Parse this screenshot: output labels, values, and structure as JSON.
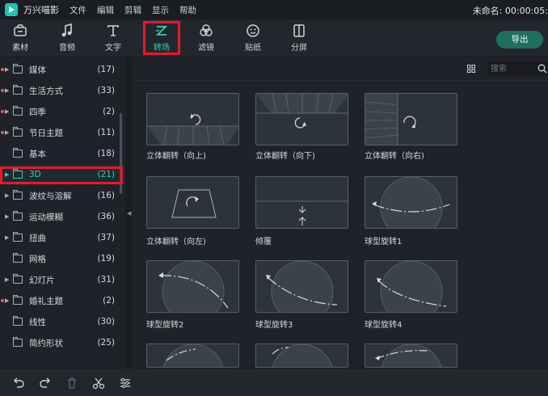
{
  "menubar": {
    "app_title": "万兴喵影",
    "items": [
      "文件",
      "编辑",
      "剪辑",
      "显示",
      "帮助"
    ],
    "project_info": "未命名: 00:00:05:"
  },
  "toolbar": {
    "tools": [
      {
        "label": "素材",
        "icon": "media-icon"
      },
      {
        "label": "音频",
        "icon": "music-note-icon"
      },
      {
        "label": "文字",
        "icon": "text-icon"
      },
      {
        "label": "转场",
        "icon": "transition-icon",
        "active": true
      },
      {
        "label": "滤镜",
        "icon": "filter-icon"
      },
      {
        "label": "贴纸",
        "icon": "sticker-icon"
      },
      {
        "label": "分屏",
        "icon": "split-screen-icon"
      }
    ],
    "export_label": "导出"
  },
  "sidebar": {
    "categories": [
      {
        "name": "媒体",
        "count": "(17)",
        "expandable": true,
        "dot": true
      },
      {
        "name": "生活方式",
        "count": "(33)",
        "expandable": true,
        "dot": true
      },
      {
        "name": "四季",
        "count": "(2)",
        "expandable": true,
        "dot": true
      },
      {
        "name": "节日主题",
        "count": "(11)",
        "expandable": true,
        "dot": true
      },
      {
        "name": "基本",
        "count": "(18)",
        "expandable": false,
        "dot": false
      },
      {
        "name": "3D",
        "count": "(21)",
        "expandable": true,
        "dot": false,
        "selected": true
      },
      {
        "name": "波纹与溶解",
        "count": "(16)",
        "expandable": true,
        "dot": false
      },
      {
        "name": "运动模糊",
        "count": "(36)",
        "expandable": true,
        "dot": false
      },
      {
        "name": "扭曲",
        "count": "(37)",
        "expandable": true,
        "dot": false
      },
      {
        "name": "网格",
        "count": "(19)",
        "expandable": false,
        "dot": false
      },
      {
        "name": "幻灯片",
        "count": "(31)",
        "expandable": true,
        "dot": false
      },
      {
        "name": "婚礼主题",
        "count": "(2)",
        "expandable": true,
        "dot": true
      },
      {
        "name": "线性",
        "count": "(30)",
        "expandable": false,
        "dot": false
      },
      {
        "name": "简约形状",
        "count": "(25)",
        "expandable": false,
        "dot": false
      }
    ]
  },
  "search": {
    "placeholder": "搜索"
  },
  "transitions": [
    {
      "label": "立体翻转（向上)",
      "kind": "flip-up"
    },
    {
      "label": "立体翻转（向下)",
      "kind": "flip-down"
    },
    {
      "label": "立体翻转（向右)",
      "kind": "flip-right"
    },
    {
      "label": "立体翻转（向左)",
      "kind": "flip-left"
    },
    {
      "label": "倾覆",
      "kind": "overturn"
    },
    {
      "label": "球型旋转1",
      "kind": "sphere-1"
    },
    {
      "label": "球型旋转2",
      "kind": "sphere-2"
    },
    {
      "label": "球型旋转3",
      "kind": "sphere-3"
    },
    {
      "label": "球型旋转4",
      "kind": "sphere-4"
    },
    {
      "label": "",
      "kind": "sphere-5"
    },
    {
      "label": "",
      "kind": "sphere-6"
    },
    {
      "label": "",
      "kind": "sphere-7"
    }
  ],
  "bottombar": {
    "icons": [
      "undo-icon",
      "redo-icon",
      "trash-icon",
      "scissors-icon",
      "adjust-icon"
    ]
  },
  "colors": {
    "accent": "#35d0bd",
    "highlight_outline": "#e8192c",
    "background": "#1f2229"
  }
}
